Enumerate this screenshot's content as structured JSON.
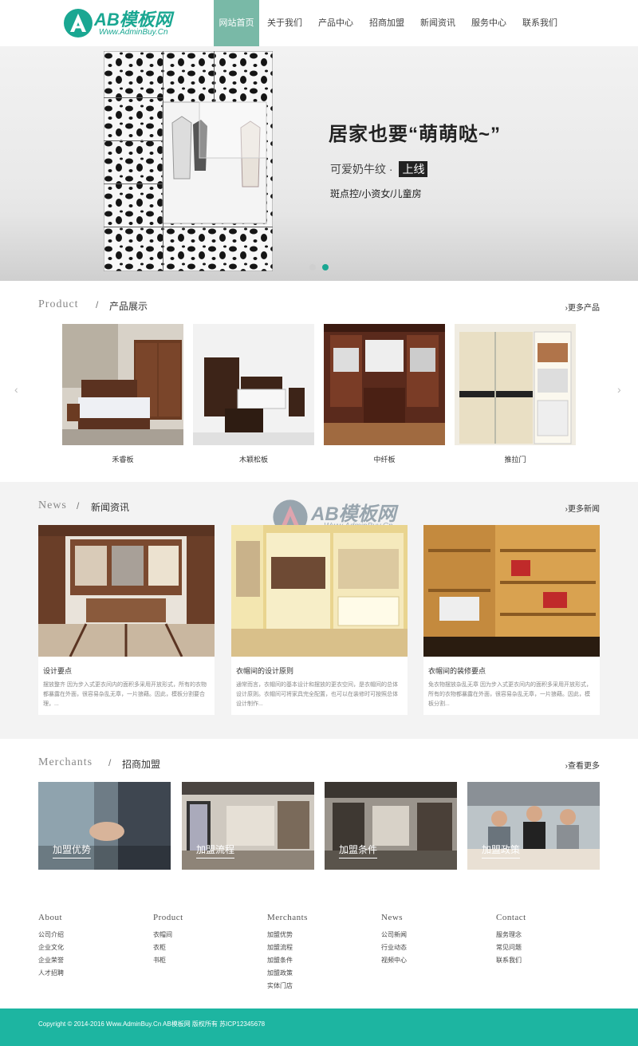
{
  "header": {
    "logo_text": "AB模板网",
    "logo_sub": "Www.AdminBuy.Cn",
    "nav": [
      "网站首页",
      "关于我们",
      "产品中心",
      "招商加盟",
      "新闻资讯",
      "服务中心",
      "联系我们"
    ]
  },
  "banner": {
    "title": "居家也要“萌萌哒~”",
    "sub": "可爱奶牛纹 · ",
    "tag": "上线",
    "sub2": "斑点控/小资女/儿童房"
  },
  "products": {
    "en": "Product",
    "cn": "产品展示",
    "more": "更多产品",
    "items": [
      "禾睿板",
      "木颖松板",
      "中纤板",
      "推拉门"
    ]
  },
  "news": {
    "en": "News",
    "cn": "新闻资讯",
    "more": "更多新闻",
    "watermark": "AB模板网",
    "watermark_sub": "Www.AdminBuy.Cn",
    "items": [
      {
        "title": "设计要点",
        "desc": "摆放整齐 因为步入式更衣间内的面积多采用开放形式，所有的衣物都暴露在外面，很容易杂乱无章，一片狼藉。因此，模板分割要合理，..."
      },
      {
        "title": "衣帽间的设计原则",
        "desc": "通常而言，衣帽间的基本设计和摆放的更衣空间，是衣帽间的总体设计原则。衣帽间可将家具完全配置，也可以在装修时可按照总体设计制作..."
      },
      {
        "title": "衣帽间的装修要点",
        "desc": "免衣物摆放杂乱无章 因为步入式更衣间内的面积多采用开放形式，所有的衣物都暴露在外面，很容易杂乱无章，一片狼藉。因此，模板分割..."
      }
    ]
  },
  "merchants": {
    "en": "Merchants",
    "cn": "招商加盟",
    "more": "查看更多",
    "items": [
      "加盟优势",
      "加盟流程",
      "加盟条件",
      "加盟政策"
    ]
  },
  "footer": {
    "cols": [
      {
        "h": "About",
        "items": [
          "公司介绍",
          "企业文化",
          "企业荣誉",
          "人才招聘"
        ]
      },
      {
        "h": "Product",
        "items": [
          "衣帽间",
          "衣柜",
          "书柜"
        ]
      },
      {
        "h": "Merchants",
        "items": [
          "加盟优势",
          "加盟流程",
          "加盟条件",
          "加盟政策",
          "实体门店"
        ]
      },
      {
        "h": "News",
        "items": [
          "公司新闻",
          "行业动态",
          "视频中心"
        ]
      },
      {
        "h": "Contact",
        "items": [
          "服务理念",
          "常见问题",
          "联系我们"
        ]
      }
    ],
    "copyright": "Copyright © 2014-2016 Www.AdminBuy.Cn AB模板网 版权所有 苏ICP12345678"
  },
  "colors": {
    "accent": "#1aa792",
    "nav_active": "#79b9a7",
    "footer_bar": "#1db5a1"
  }
}
